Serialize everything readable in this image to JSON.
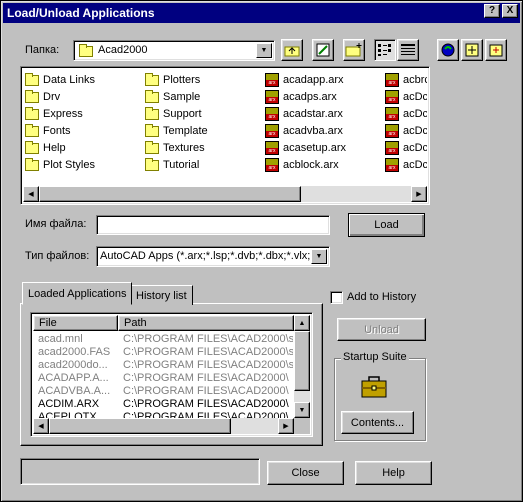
{
  "window": {
    "title": "Load/Unload Applications",
    "help_btn": "?",
    "close_btn": "X"
  },
  "lookin": {
    "label": "Папка:",
    "value": "Acad2000"
  },
  "toolbar": {
    "up": "up-folder-icon",
    "favorites": "favorites-icon",
    "new_folder": "new-folder-icon",
    "list_view": "list-view-icon",
    "details_view": "details-view-icon",
    "find": "find-icon",
    "locate": "locate-icon",
    "browse": "browse-icon"
  },
  "files": {
    "col1": [
      "Data Links",
      "Drv",
      "Express",
      "Fonts",
      "Help",
      "Plot Styles"
    ],
    "col2": [
      "Plotters",
      "Sample",
      "Support",
      "Template",
      "Textures",
      "Tutorial"
    ],
    "col3": [
      "acadapp.arx",
      "acadps.arx",
      "acadstar.arx",
      "acadvba.arx",
      "acasetup.arx",
      "acblock.arx"
    ],
    "col4": [
      "acbrc",
      "acDc",
      "acDc",
      "acDc",
      "acDc",
      "acDc"
    ]
  },
  "filename": {
    "label": "Имя файла:",
    "value": ""
  },
  "filetype": {
    "label": "Тип файлов:",
    "value": "AutoCAD Apps (*.arx;*.lsp;*.dvb;*.dbx;*.vlx;*."
  },
  "load_btn": "Load",
  "tabs": {
    "loaded": "Loaded Applications",
    "history": "History list"
  },
  "list": {
    "col_file": "File",
    "col_path": "Path",
    "rows": [
      {
        "file": "acad.mnl",
        "path": "C:\\PROGRAM FILES\\ACAD2000\\s",
        "dim": true
      },
      {
        "file": "acad2000.FAS",
        "path": "C:\\PROGRAM FILES\\ACAD2000\\s",
        "dim": true
      },
      {
        "file": "acad2000do...",
        "path": "C:\\PROGRAM FILES\\ACAD2000\\s",
        "dim": true
      },
      {
        "file": "ACADAPP.A...",
        "path": "C:\\PROGRAM FILES\\ACAD2000\\",
        "dim": true
      },
      {
        "file": "ACADVBA.A...",
        "path": "C:\\PROGRAM FILES\\ACAD2000\\",
        "dim": true
      },
      {
        "file": "ACDIM.ARX",
        "path": "C:\\PROGRAM FILES\\ACAD2000\\",
        "dim": false
      },
      {
        "file": "ACEPLOTX...",
        "path": "C:\\PROGRAM FILES\\ACAD2000\\",
        "dim": false
      }
    ]
  },
  "add_history": "Add to History",
  "unload_btn": "Unload",
  "startup": {
    "title": "Startup Suite",
    "contents_btn": "Contents..."
  },
  "status_text": "",
  "close_btn": "Close",
  "help_btn": "Help"
}
